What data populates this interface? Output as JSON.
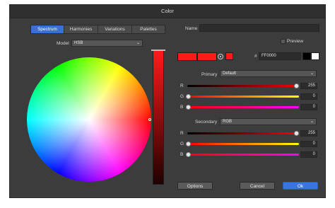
{
  "window": {
    "title": "Color"
  },
  "tabs": [
    {
      "label": "Spectrum"
    },
    {
      "label": "Harmonies"
    },
    {
      "label": "Variations"
    },
    {
      "label": "Palettes"
    }
  ],
  "model": {
    "label": "Model",
    "value": "HSB"
  },
  "name": {
    "label": "Name",
    "value": ""
  },
  "preview": {
    "label": "Preview",
    "checked": false
  },
  "hex": {
    "label": "#",
    "value": "FF0000"
  },
  "colors": {
    "current": "#ff1a1a",
    "accent": "#3a74e0"
  },
  "primary": {
    "label": "Primary",
    "mode": "Default",
    "channels": [
      {
        "label": "R",
        "value": "255",
        "fraction": 1.0
      },
      {
        "label": "G",
        "value": "0",
        "fraction": 0.0
      },
      {
        "label": "B",
        "value": "0",
        "fraction": 0.0
      }
    ]
  },
  "secondary": {
    "label": "Secondary",
    "mode": "RGB",
    "channels": [
      {
        "label": "R",
        "value": "255",
        "fraction": 1.0
      },
      {
        "label": "G",
        "value": "0",
        "fraction": 0.0
      },
      {
        "label": "B",
        "value": "0",
        "fraction": 0.0
      }
    ]
  },
  "buttons": {
    "options": "Options",
    "cancel": "Cancel",
    "ok": "Ok"
  }
}
